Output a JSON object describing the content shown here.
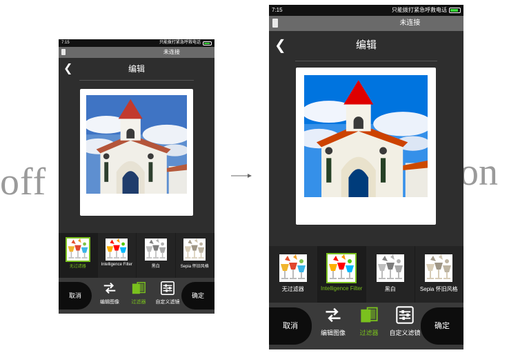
{
  "labels": {
    "before": "off",
    "after": "on"
  },
  "status": {
    "time": "7:15",
    "notice": "只能拨打紧急呼救电话"
  },
  "connection": "未连接",
  "title": "编辑",
  "filters": [
    {
      "label": "无过滤器"
    },
    {
      "label": "Intelligence Filter"
    },
    {
      "label": "黑白"
    },
    {
      "label": "Sepia 怀旧风格"
    }
  ],
  "actions": {
    "cancel": "取消",
    "confirm": "确定"
  },
  "tools": [
    {
      "label": "编辑图像",
      "icon": "swap-arrows-icon"
    },
    {
      "label": "过滤器",
      "icon": "filter-icon"
    },
    {
      "label": "自定义滤镜",
      "icon": "sliders-icon"
    }
  ],
  "colors": {
    "accent": "#7ac11e",
    "background": "#2e2e2e"
  },
  "screens": [
    {
      "selected_filter": 0
    },
    {
      "selected_filter": 1
    }
  ]
}
